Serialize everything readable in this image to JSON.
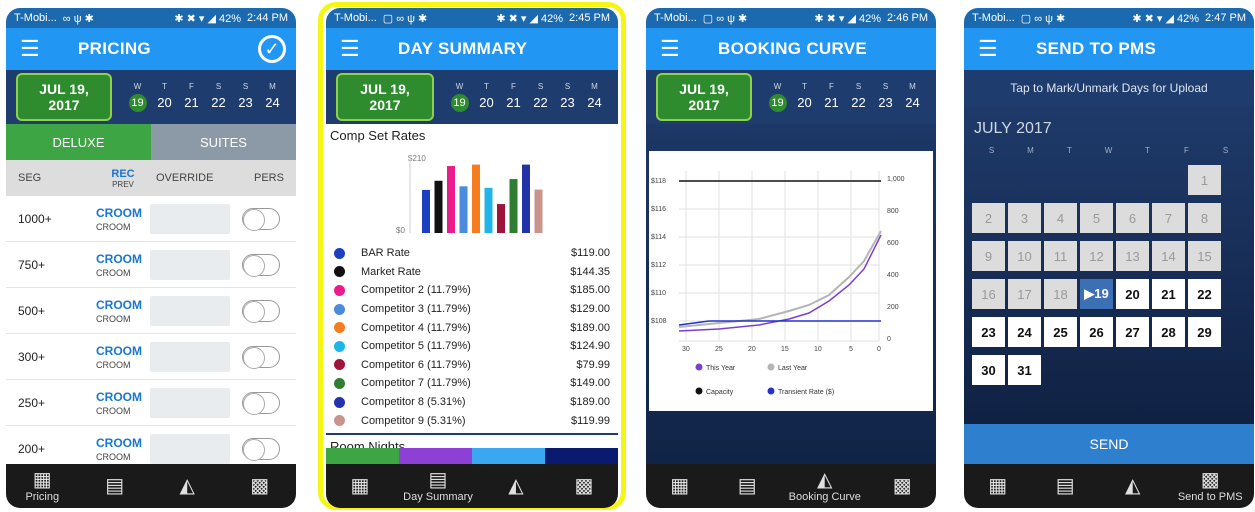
{
  "status": [
    {
      "carrier": "T-Mobi...",
      "icons": "∞ ψ ✱",
      "right": "✱ ✖ ▾ ◢ 42%",
      "time": "2:44 PM"
    },
    {
      "carrier": "T-Mobi...",
      "icons": "▢ ∞ ψ ✱",
      "right": "✱ ✖ ▾ ◢ 42%",
      "time": "2:45 PM"
    },
    {
      "carrier": "T-Mobi...",
      "icons": "▢ ∞ ψ ✱",
      "right": "✱ ✖ ▾ ◢ 42%",
      "time": "2:46 PM"
    },
    {
      "carrier": "T-Mobi...",
      "icons": "▢ ∞ ψ ✱",
      "right": "✱ ✖ ▾ ◢ 42%",
      "time": "2:47 PM"
    }
  ],
  "titles": [
    "PRICING",
    "DAY SUMMARY",
    "BOOKING CURVE",
    "SEND TO PMS"
  ],
  "datebar": {
    "date": "JUL 19, 2017",
    "days": [
      {
        "l": "W",
        "n": "19"
      },
      {
        "l": "T",
        "n": "20"
      },
      {
        "l": "F",
        "n": "21"
      },
      {
        "l": "S",
        "n": "22"
      },
      {
        "l": "S",
        "n": "23"
      },
      {
        "l": "M",
        "n": "24"
      }
    ]
  },
  "pricing": {
    "tabs": [
      "DELUXE",
      "SUITES"
    ],
    "headers": {
      "seg": "SEG",
      "rec": "REC",
      "prev": "PREV",
      "override": "OVERRIDE",
      "pers": "PERS"
    },
    "rows": [
      {
        "seg": "1000+",
        "rec": "CROOM",
        "prev": "CROOM"
      },
      {
        "seg": "750+",
        "rec": "CROOM",
        "prev": "CROOM"
      },
      {
        "seg": "500+",
        "rec": "CROOM",
        "prev": "CROOM"
      },
      {
        "seg": "300+",
        "rec": "CROOM",
        "prev": "CROOM"
      },
      {
        "seg": "250+",
        "rec": "CROOM",
        "prev": "CROOM"
      },
      {
        "seg": "200+",
        "rec": "CROOM",
        "prev": "CROOM"
      }
    ]
  },
  "summary": {
    "section": "Comp Set Rates",
    "ymax": "$210",
    "ymin": "$0",
    "bars": [
      {
        "v": 119.0,
        "c": "#1a3fbf"
      },
      {
        "v": 144.35,
        "c": "#111111"
      },
      {
        "v": 185.0,
        "c": "#e91e8c"
      },
      {
        "v": 129.0,
        "c": "#4a8be0"
      },
      {
        "v": 189.0,
        "c": "#f57c20"
      },
      {
        "v": 124.9,
        "c": "#1fb5e8"
      },
      {
        "v": 79.99,
        "c": "#a0143c"
      },
      {
        "v": 149.0,
        "c": "#2e7d32"
      },
      {
        "v": 189.0,
        "c": "#2233aa"
      },
      {
        "v": 119.99,
        "c": "#c8948c"
      }
    ],
    "legend": [
      {
        "name": "BAR Rate",
        "value": "$119.00",
        "color": "#1a3fbf"
      },
      {
        "name": "Market Rate",
        "value": "$144.35",
        "color": "#111111"
      },
      {
        "name": "Competitor 2 (11.79%)",
        "value": "$185.00",
        "color": "#e91e8c"
      },
      {
        "name": "Competitor 3 (11.79%)",
        "value": "$129.00",
        "color": "#4a8be0"
      },
      {
        "name": "Competitor 4 (11.79%)",
        "value": "$189.00",
        "color": "#f57c20"
      },
      {
        "name": "Competitor 5 (11.79%)",
        "value": "$124.90",
        "color": "#1fb5e8"
      },
      {
        "name": "Competitor 6 (11.79%)",
        "value": "$79.99",
        "color": "#a0143c"
      },
      {
        "name": "Competitor 7 (11.79%)",
        "value": "$149.00",
        "color": "#2e7d32"
      },
      {
        "name": "Competitor 8 (5.31%)",
        "value": "$189.00",
        "color": "#2233aa"
      },
      {
        "name": "Competitor 9 (5.31%)",
        "value": "$119.99",
        "color": "#c8948c"
      }
    ],
    "section2": "Room Nights",
    "band": [
      "#3da544",
      "#8e3fd6",
      "#3aa8f0",
      "#0a1a6e"
    ]
  },
  "booking": {
    "yleft": [
      "$118",
      "$116",
      "$114",
      "$112",
      "$110",
      "$108"
    ],
    "yright": [
      "1,000",
      "800",
      "600",
      "400",
      "200",
      "0"
    ],
    "xticks": [
      "30",
      "25",
      "20",
      "15",
      "10",
      "5",
      "0"
    ],
    "legend": [
      {
        "name": "This Year",
        "color": "#7b3fd0"
      },
      {
        "name": "Last Year",
        "color": "#b5b5b5"
      },
      {
        "name": "Capacity",
        "color": "#111111"
      },
      {
        "name": "Transient Rate ($)",
        "color": "#2233cc"
      }
    ]
  },
  "pms": {
    "hint": "Tap to Mark/Unmark Days for Upload",
    "month": "JULY 2017",
    "dow": [
      "S",
      "M",
      "T",
      "W",
      "T",
      "F",
      "S"
    ],
    "send": "SEND"
  },
  "nav": {
    "pricing": "Pricing",
    "summary": "Day Summary",
    "curve": "Booking Curve",
    "pms": "Send to PMS"
  }
}
